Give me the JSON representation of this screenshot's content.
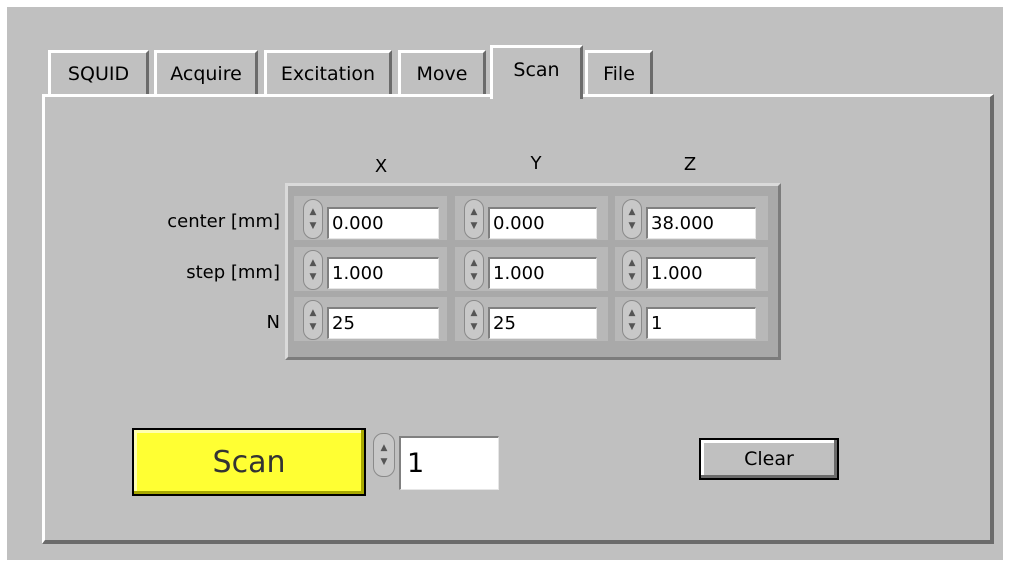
{
  "tabs": [
    {
      "label": "SQUID"
    },
    {
      "label": "Acquire"
    },
    {
      "label": "Excitation"
    },
    {
      "label": "Move"
    },
    {
      "label": "Scan",
      "active": true
    },
    {
      "label": "File"
    }
  ],
  "scan_panel": {
    "columns": [
      "X",
      "Y",
      "Z"
    ],
    "rows": [
      {
        "label": "center [mm]",
        "values": [
          "0.000",
          "0.000",
          "38.000"
        ]
      },
      {
        "label": "step [mm]",
        "values": [
          "1.000",
          "1.000",
          "1.000"
        ]
      },
      {
        "label": "N",
        "values": [
          "25",
          "25",
          "1"
        ]
      }
    ],
    "scan_button_label": "Scan",
    "repeat_count": "1",
    "clear_button_label": "Clear"
  },
  "icons": {
    "spinner": "up-down-arrows-icon"
  },
  "colors": {
    "panel": "#c0c0c0",
    "scan_button": "#ffff33",
    "array_frame": "#a9a9a9"
  }
}
